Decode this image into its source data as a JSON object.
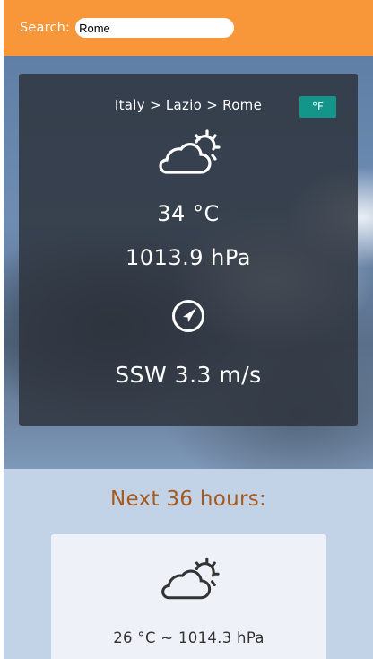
{
  "header": {
    "search_label": "Search:",
    "search_value": "Rome"
  },
  "current": {
    "breadcrumb": "Italy > Lazio > Rome",
    "unit_toggle_label": "°F",
    "condition_icon": "partly-cloudy-icon",
    "temperature": "34 °C",
    "pressure": "1013.9 hPa",
    "wind_direction_icon": "compass-icon",
    "wind": "SSW 3.3 m/s"
  },
  "forecast": {
    "title": "Next 36 hours:",
    "items": [
      {
        "condition_icon": "partly-cloudy-icon",
        "summary": "26 °C ~ 1014.3 hPa"
      }
    ]
  },
  "colors": {
    "header_bg": "#f7973a",
    "unit_button_bg": "#14958a",
    "forecast_title": "#a45a1e",
    "forecast_bg": "#c3d3e7"
  }
}
